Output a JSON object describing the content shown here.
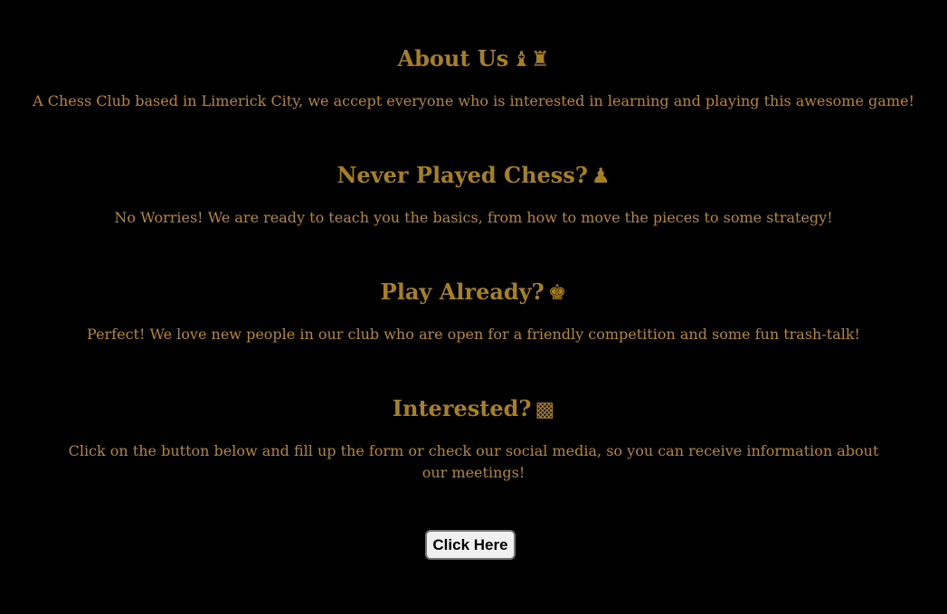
{
  "sections": [
    {
      "heading": "About Us",
      "glyph": "♝♜",
      "icon": "chess-bishop-rook-icon",
      "body": "A Chess Club based in Limerick City, we accept everyone who is interested in learning and playing this awesome game!"
    },
    {
      "heading": "Never Played Chess?",
      "glyph": "♟",
      "icon": "chess-pawn-icon",
      "body": "No Worries! We are ready to teach you the basics, from how to move the pieces to some strategy!"
    },
    {
      "heading": "Play Already?",
      "glyph": "♚",
      "icon": "chess-king-icon",
      "body": "Perfect! We love new people in our club who are open for a friendly competition and some fun trash-talk!"
    },
    {
      "heading": "Interested?",
      "glyph": "▩",
      "icon": "checkerboard-icon",
      "body": "Click on the button below and fill up the form or check our social media, so you can receive information about our meetings!"
    }
  ],
  "cta": {
    "label": "Click Here"
  },
  "colors": {
    "background": "#000000",
    "heading": "#a8801e",
    "text": "#b8862b"
  }
}
